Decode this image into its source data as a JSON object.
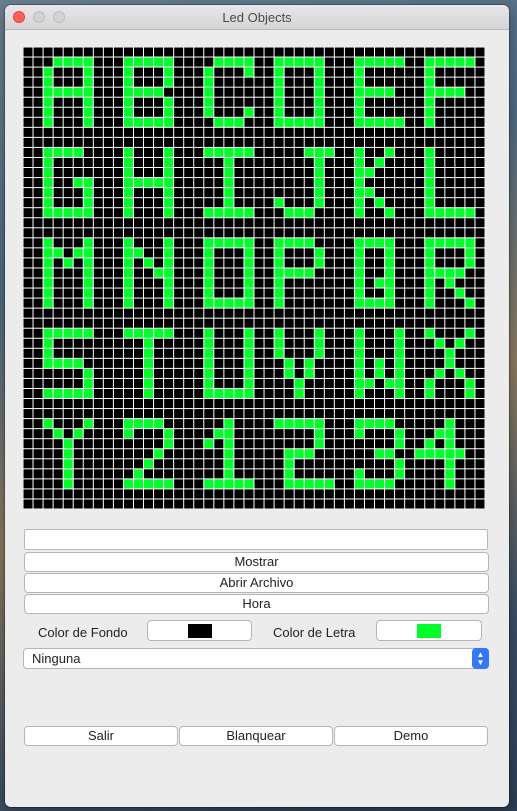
{
  "window": {
    "title": "Led Objects"
  },
  "led": {
    "on_color": "#00ff2a",
    "off_color": "#000000",
    "grid_color": "#ffffff",
    "size": 46,
    "rows": [
      "..............................................",
      "...####...#####....####..#####...#####..#####.",
      "..#...#...#...#...#...#..#...#...#......#.....",
      "..#...#...#...#...#......#...#...#......#.....",
      "..#####...####....#......#...#...####...####..",
      "..#...#...#...#...#......#...#...#......#.....",
      "..#...#...#...#...#...#..#...#...#......#.....",
      "..#...#...#####....###...#####...#####..#.....",
      "..............................................",
      "..............................................",
      "..####....#...#...#####.....###..#..#...#.....",
      "..#.......#...#.....#........#...#.#....#.....",
      "..#.......#...#.....#........#...##.....#.....",
      "..#..##...#####.....#........#...#......#.....",
      "..#...#...#...#.....#........#...##.....#.....",
      "..#...#...#...#.....#....#...#...#.#....#.....",
      "..#####...#...#...#####...###....#..#...#####.",
      "..............................................",
      "..............................................",
      "..#...#...#...#...#####..####....####...#####.",
      "..##.##...##..#...#...#..#...#...#..#...#...#.",
      "..#.#.#...#.#.#...#...#..#...#...#..#...#...#.",
      "..#...#...#..##...#...#..####....#..#...####..",
      "..#...#...#...#...#...#..#.......#.##...#.#...",
      "..#...#...#...#...#...#..#.......#..#...#..#..",
      "..#...#...#...#...#####..#.......####...#...#.",
      "..............................................",
      "..............................................",
      "..#####...#####...#...#..#...#...#...#..#...#.",
      "..#.........#.....#...#..#...#...#...#...#.#..",
      "..#.........#.....#...#..#...#...#...#....#...",
      "..####......#.....#...#...#.#....#.#.#....#...",
      "......#.....#.....#...#...#.#....#.#.#...#.#..",
      "......#.....#.....#...#....#.....##.##..#...#.",
      "..#####.....#.....#####....#.....#...#..#...#.",
      "..............................................",
      "..............................................",
      "..#...#...####......#....#####...####.....#...",
      "...#.#....#...#....##........#...#...#...##...",
      "....#.........#...#.#........#.......#..#.#...",
      "....#........#......#.....###......##..#####..",
      "....#.......#.......#.....#..........#....#...",
      "....#......#........#.....#......#...#....#...",
      "....#.....#####...#####...#####..####.....#...",
      "..............................................",
      ".............................................."
    ]
  },
  "input": {
    "value": "",
    "placeholder": ""
  },
  "buttons": {
    "mostrar": "Mostrar",
    "abrir": "Abrir Archivo",
    "hora": "Hora",
    "salir": "Salir",
    "blanquear": "Blanquear",
    "demo": "Demo"
  },
  "colors": {
    "fondo_label": "Color de Fondo",
    "fondo": "#000000",
    "letra_label": "Color de Letra",
    "letra": "#00ff2a"
  },
  "select": {
    "value": "Ninguna"
  }
}
